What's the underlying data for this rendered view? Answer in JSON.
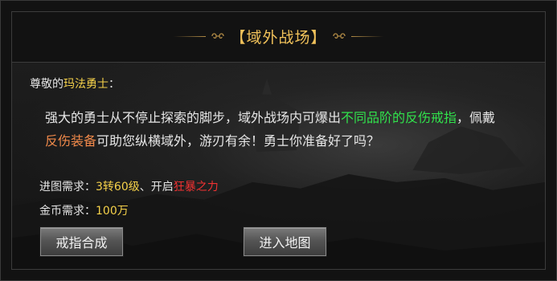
{
  "title": "【域外战场】",
  "greeting": {
    "prefix": "尊敬的",
    "name": "玛法勇士",
    "suffix": "："
  },
  "description": {
    "part1": "强大的勇士从不停止探索的脚步，域外战场内可爆出",
    "highlight1": "不同品阶的反伤戒指",
    "part2": "，佩戴",
    "highlight2": "反伤装备",
    "part3": "可助您纵横域外，游刃有余！勇士你准备好了吗？"
  },
  "requirements": {
    "map_label": "进图需求：",
    "map_value": "3转60级",
    "map_sep": "、开启",
    "map_power": "狂暴之力",
    "gold_label": "金币需求：",
    "gold_value": "100万"
  },
  "buttons": {
    "ring_synthesis": "戒指合成",
    "enter_map": "进入地图"
  },
  "colors": {
    "title": "#f0c15a",
    "name_highlight": "#f5d14a",
    "item_green": "#31e24c",
    "equip_orange": "#f0894a",
    "power_red": "#f03232"
  }
}
